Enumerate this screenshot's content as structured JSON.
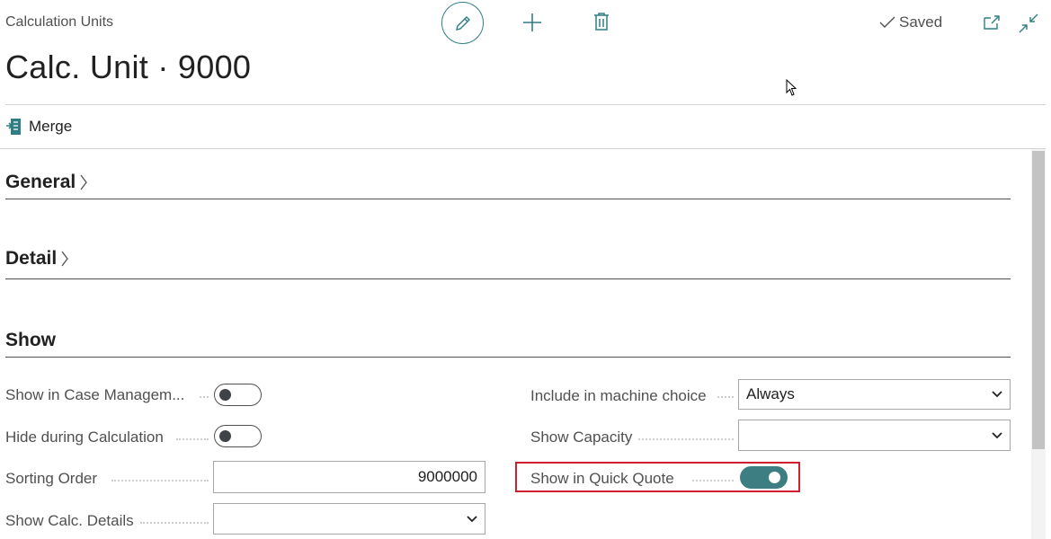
{
  "header": {
    "breadcrumb": "Calculation Units",
    "title": "Calc. Unit · 9000",
    "status": "Saved",
    "tools": [
      "pencil-icon",
      "plus-icon",
      "trash-icon",
      "open-in-new-window-icon",
      "collapse-icon"
    ]
  },
  "actions": {
    "merge_label": "Merge"
  },
  "sections": {
    "general": "General",
    "detail": "Detail",
    "show": "Show"
  },
  "fields": {
    "show_in_case_management": {
      "label": "Show in Case Managem...",
      "value": false
    },
    "hide_during_calculation": {
      "label": "Hide during Calculation",
      "value": false
    },
    "sorting_order": {
      "label": "Sorting Order",
      "value": "9000000"
    },
    "show_calc_details": {
      "label": "Show Calc. Details",
      "value": ""
    },
    "include_in_machine_choice": {
      "label": "Include in machine choice",
      "value": "Always"
    },
    "show_capacity": {
      "label": "Show Capacity",
      "value": ""
    },
    "show_in_quick_quote": {
      "label": "Show in Quick Quote",
      "value": true
    }
  },
  "colors": {
    "accent": "#2f7e83",
    "highlight_border": "#d0202f",
    "text": "#212121",
    "muted": "#505050"
  }
}
